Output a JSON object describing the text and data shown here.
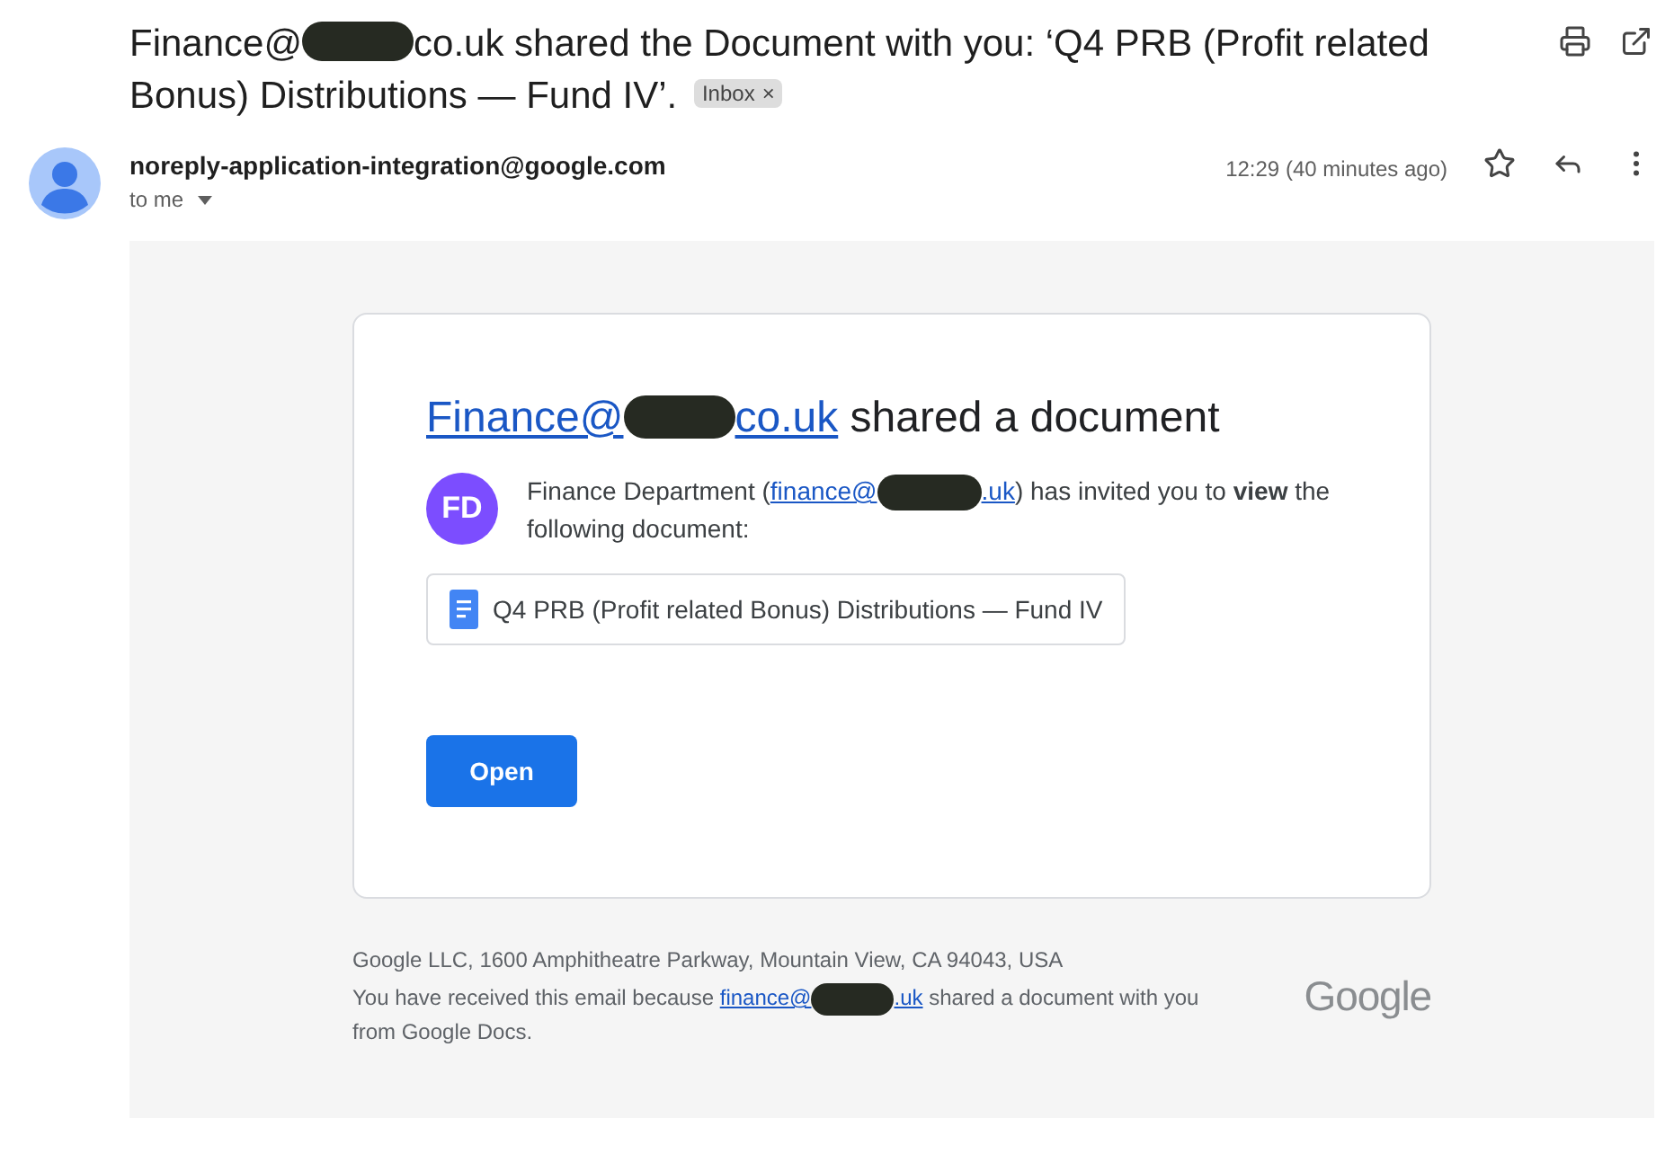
{
  "subject": {
    "start": "Finance@",
    "end": "co.uk shared the Document with you: ‘Q4 PRB (Profit related Bonus) Distributions — Fund IV’.",
    "label": "Inbox",
    "label_close": "×"
  },
  "sender": {
    "address": "noreply-application-integration@google.com",
    "recipient": "to me",
    "time": "12:29 (40 minutes ago)"
  },
  "card": {
    "heading_link_start": "Finance@",
    "heading_link_end": "co.uk",
    "heading_rest": "shared a document",
    "avatar": "FD",
    "invite_before": "Finance Department (",
    "invite_link_start": "finance@",
    "invite_link_end": ".uk",
    "invite_after": ") has invited you to **view** the following document:",
    "document": "Q4 PRB (Profit related Bonus) Distributions — Fund IV",
    "button": "Open"
  },
  "footer": {
    "address": "Google LLC, 1600 Amphitheatre Parkway, Mountain View, CA 94043, USA",
    "reason_before": "You have received this email because ",
    "link_start": "finance@",
    "link_end": ".uk",
    "reason_after": " shared a document with you from Google Docs.",
    "logo": "Google"
  }
}
